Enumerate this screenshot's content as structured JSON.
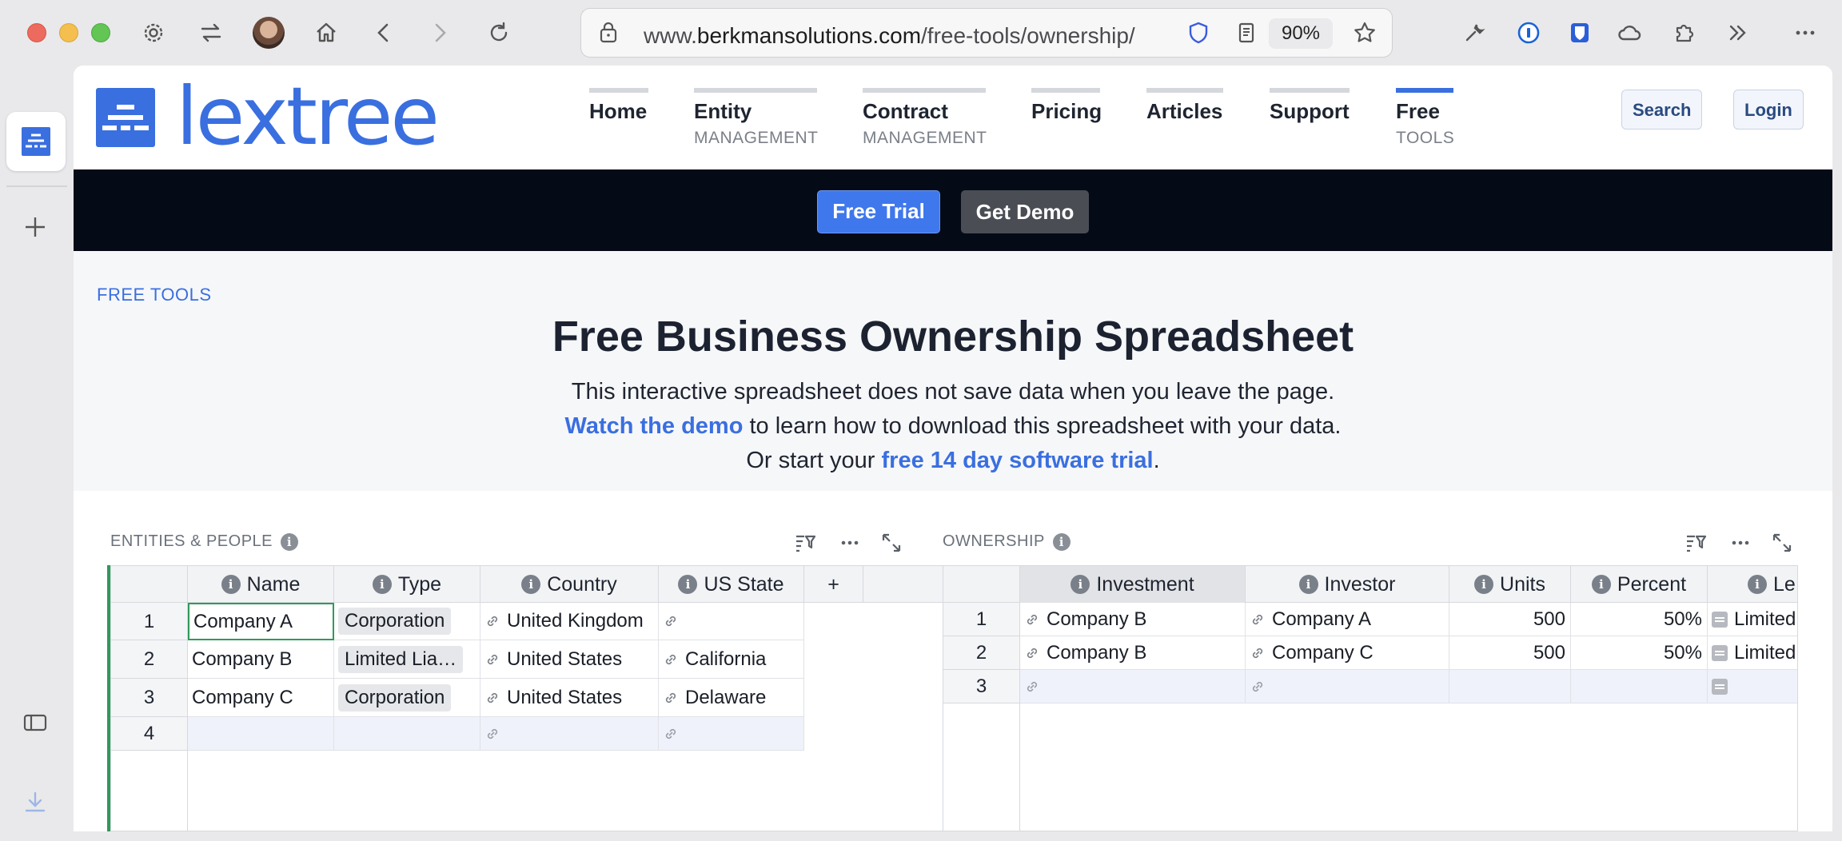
{
  "browser": {
    "url_prefix": "www.",
    "url_domain": "berkmansolutions.com",
    "url_path": "/free-tools/ownership/",
    "zoom": "90%"
  },
  "site": {
    "logo_text": "lextree",
    "nav": [
      {
        "label": "Home",
        "sub": ""
      },
      {
        "label": "Entity",
        "sub": "MANAGEMENT"
      },
      {
        "label": "Contract",
        "sub": "MANAGEMENT"
      },
      {
        "label": "Pricing",
        "sub": ""
      },
      {
        "label": "Articles",
        "sub": ""
      },
      {
        "label": "Support",
        "sub": ""
      },
      {
        "label": "Free",
        "sub": "TOOLS"
      }
    ],
    "search_label": "Search",
    "login_label": "Login",
    "free_trial_label": "Free Trial",
    "get_demo_label": "Get Demo"
  },
  "hero": {
    "eyebrow": "FREE TOOLS",
    "title": "Free Business Ownership Spreadsheet",
    "line1": "This interactive spreadsheet does not save data when you leave the page.",
    "line2_link": "Watch the demo",
    "line2_rest": " to learn how to download this spreadsheet with your data.",
    "line3_pre": "Or start your ",
    "line3_link": "free 14 day software trial",
    "line3_post": "."
  },
  "entities": {
    "title": "ENTITIES & PEOPLE",
    "columns": [
      "Name",
      "Type",
      "Country",
      "US State"
    ],
    "add_column": "+",
    "rows": [
      {
        "num": "1",
        "name": "Company A",
        "type": "Corporation",
        "country": "United Kingdom",
        "state": ""
      },
      {
        "num": "2",
        "name": "Company B",
        "type": "Limited Lia…",
        "country": "United States",
        "state": "California"
      },
      {
        "num": "3",
        "name": "Company C",
        "type": "Corporation",
        "country": "United States",
        "state": "Delaware"
      },
      {
        "num": "4",
        "name": "",
        "type": "",
        "country": "",
        "state": ""
      }
    ]
  },
  "ownership": {
    "title": "OWNERSHIP",
    "columns": [
      "Investment",
      "Investor",
      "Units",
      "Percent",
      "Le"
    ],
    "rows": [
      {
        "num": "1",
        "investment": "Company B",
        "investor": "Company A",
        "units": "500",
        "percent": "50%",
        "type": "Limited"
      },
      {
        "num": "2",
        "investment": "Company B",
        "investor": "Company C",
        "units": "500",
        "percent": "50%",
        "type": "Limited"
      },
      {
        "num": "3",
        "investment": "",
        "investor": "",
        "units": "",
        "percent": "",
        "type": ""
      }
    ]
  }
}
